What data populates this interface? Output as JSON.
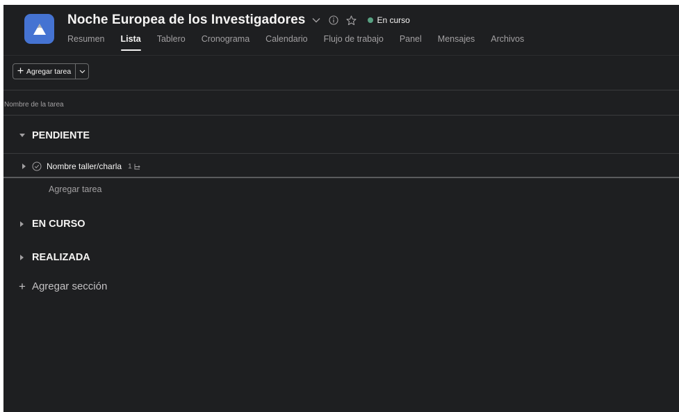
{
  "project": {
    "title": "Noche Europea de los Investigadores",
    "status_label": "En curso",
    "status_color": "#58a182",
    "icon_color": "#4573d2",
    "icon": "mountain-icon"
  },
  "tabs": [
    {
      "label": "Resumen",
      "active": false
    },
    {
      "label": "Lista",
      "active": true
    },
    {
      "label": "Tablero",
      "active": false
    },
    {
      "label": "Cronograma",
      "active": false
    },
    {
      "label": "Calendario",
      "active": false
    },
    {
      "label": "Flujo de trabajo",
      "active": false
    },
    {
      "label": "Panel",
      "active": false
    },
    {
      "label": "Mensajes",
      "active": false
    },
    {
      "label": "Archivos",
      "active": false
    }
  ],
  "toolbar": {
    "add_task_label": "Agregar tarea"
  },
  "list": {
    "column_header": "Nombre de la tarea",
    "sections": [
      {
        "title": "PENDIENTE",
        "expanded": true,
        "tasks": [
          {
            "name": "Nombre taller/charla",
            "subtask_count": "1"
          }
        ],
        "add_task_label": "Agregar tarea"
      },
      {
        "title": "EN CURSO",
        "expanded": false
      },
      {
        "title": "REALIZADA",
        "expanded": false
      }
    ],
    "add_section_label": "Agregar sección"
  },
  "theme": {
    "background": "#1e1f21",
    "text": "#f5f4f3",
    "muted_text": "#a2a0a2",
    "divider": "#3a3b3d"
  }
}
